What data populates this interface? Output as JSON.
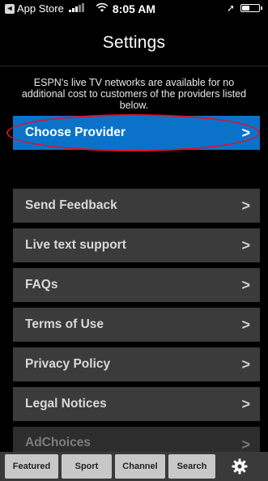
{
  "status_bar": {
    "back_app": "App Store",
    "time": "8:05 AM",
    "back_glyph": "◂",
    "location_glyph": "➚",
    "battery_level": 0.45
  },
  "page": {
    "title": "Settings"
  },
  "info_text": "ESPN's live TV networks are available for no additional cost to customers of the providers listed below.",
  "menu": {
    "choose_provider": "Choose Provider",
    "send_feedback": "Send Feedback",
    "live_text_support": "Live text support",
    "faqs": "FAQs",
    "terms": "Terms of Use",
    "privacy": "Privacy Policy",
    "legal": "Legal Notices",
    "adchoices": "AdChoices",
    "chevron_glyph": ">"
  },
  "tabs": {
    "featured": "Featured",
    "sport": "Sport",
    "channel": "Channel",
    "search": "Search",
    "settings_icon": "gear-icon"
  },
  "colors": {
    "primary_row": "#0a73c9",
    "secondary_row": "#3b3b3b",
    "annotation_circle": "#e0102a"
  }
}
